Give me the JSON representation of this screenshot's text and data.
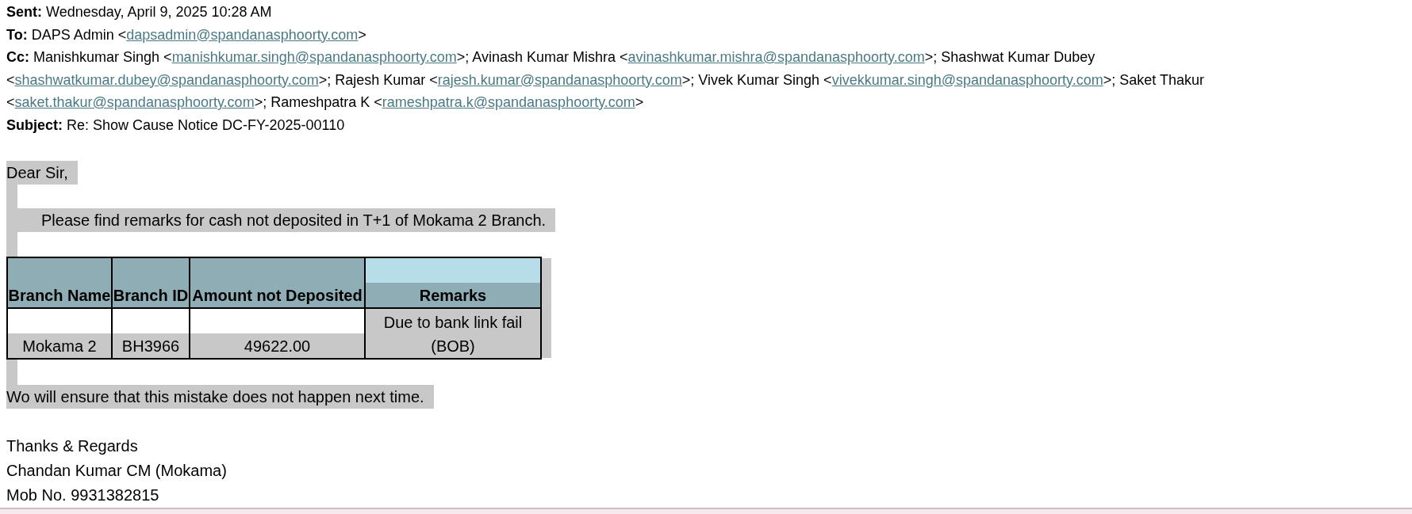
{
  "headers": [
    {
      "label": "Sent:",
      "parts": [
        {
          "kind": "text",
          "text": "Wednesday, April 9, 2025 10:28 AM"
        }
      ]
    },
    {
      "label": "To:",
      "parts": [
        {
          "kind": "text",
          "text": "DAPS Admin <"
        },
        {
          "kind": "link",
          "text": "dapsadmin@spandanasphoorty.com"
        },
        {
          "kind": "text",
          "text": ">"
        }
      ]
    },
    {
      "label": "Cc:",
      "parts": [
        {
          "kind": "text",
          "text": "Manishkumar Singh <"
        },
        {
          "kind": "link",
          "text": "manishkumar.singh@spandanasphoorty.com"
        },
        {
          "kind": "text",
          "text": ">; Avinash Kumar Mishra <"
        },
        {
          "kind": "link",
          "text": "avinashkumar.mishra@spandanasphoorty.com"
        },
        {
          "kind": "text",
          "text": ">; Shashwat Kumar Dubey <"
        },
        {
          "kind": "link",
          "text": "shashwatkumar.dubey@spandanasphoorty.com"
        },
        {
          "kind": "text",
          "text": ">; Rajesh Kumar <"
        },
        {
          "kind": "link",
          "text": "rajesh.kumar@spandanasphoorty.com"
        },
        {
          "kind": "text",
          "text": ">; Vivek Kumar Singh <"
        },
        {
          "kind": "link",
          "text": "vivekkumar.singh@spandanasphoorty.com"
        },
        {
          "kind": "text",
          "text": ">; Saket Thakur <"
        },
        {
          "kind": "link",
          "text": "saket.thakur@spandanasphoorty.com"
        },
        {
          "kind": "text",
          "text": ">; Rameshpatra K <"
        },
        {
          "kind": "link",
          "text": "rameshpatra.k@spandanasphoorty.com"
        },
        {
          "kind": "text",
          "text": ">"
        }
      ]
    },
    {
      "label": "Subject:",
      "parts": [
        {
          "kind": "text",
          "text": "Re: Show Cause Notice DC-FY-2025-00110"
        }
      ]
    }
  ],
  "greeting": {
    "text": "Dear Sir,",
    "highlighted": true
  },
  "intro": {
    "text": "Please find remarks for cash not deposited in T+1 of Mokama 2 Branch.",
    "highlighted": true
  },
  "table": {
    "columns": [
      "Branch Name",
      "Branch ID",
      "Amount not Deposited",
      "Remarks"
    ],
    "rows": [
      [
        "Mokama 2",
        "BH3966",
        "49622.00",
        "Due to bank link fail   (BOB)"
      ]
    ]
  },
  "closing": {
    "text": "Wo will ensure that this mistake does not happen next time.",
    "highlighted": true
  },
  "signature": [
    "Thanks & Regards",
    "Chandan Kumar CM (Mokama)",
    "Mob No. 9931382815"
  ]
}
